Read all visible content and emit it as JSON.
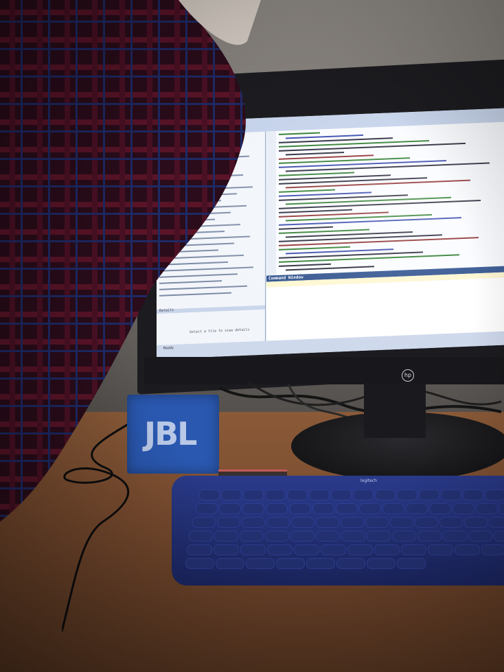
{
  "photo": {
    "description_colors": {
      "screen": "#dbe6f5",
      "keyboard": "#1c2764",
      "speaker": "#2a58b0",
      "shirt": "#4a1020"
    }
  },
  "screen": {
    "command_window_title": "Command Window",
    "status_text": "Ready",
    "details_label": "Details",
    "select_hint": "Select a file to view details"
  },
  "speaker": {
    "brand": "JBL"
  },
  "monitor": {
    "brand": "hp"
  },
  "keyboard": {
    "brand": "logitech"
  }
}
